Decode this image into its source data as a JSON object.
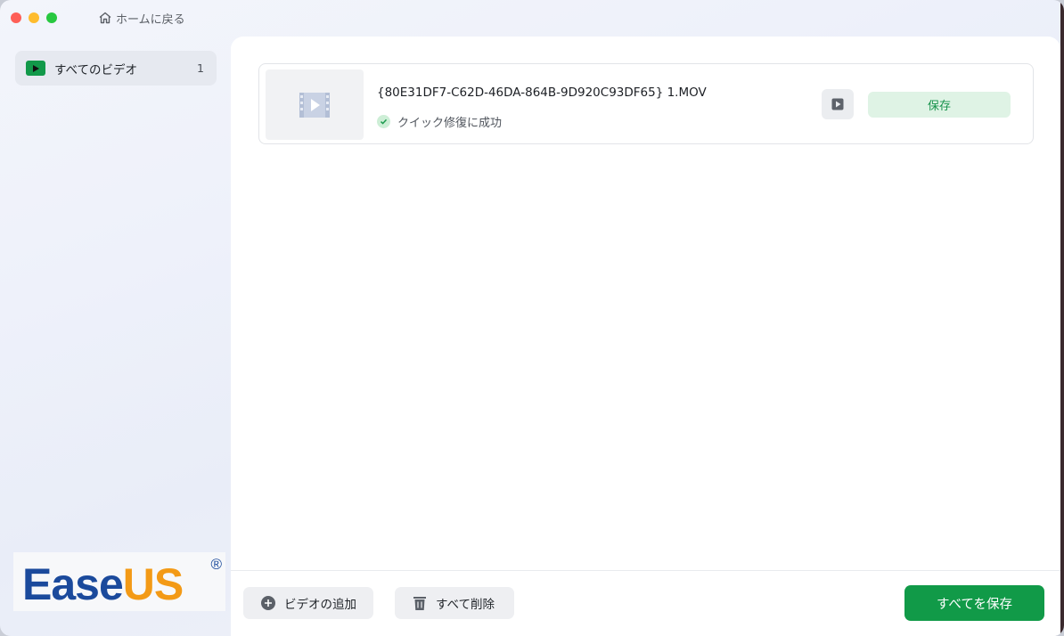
{
  "window": {
    "home_link": "ホームに戻る"
  },
  "sidebar": {
    "items": [
      {
        "label": "すべてのビデオ",
        "count": "1",
        "icon": "video-play-icon",
        "color": "#12994a"
      }
    ],
    "logo": {
      "part1": "Ease",
      "part2": "US",
      "mark": "®"
    }
  },
  "main": {
    "files": [
      {
        "name": "{80E31DF7-C62D-46DA-864B-9D920C93DF65} 1.MOV",
        "status": "クイック修復に成功",
        "save_label": "保存"
      }
    ]
  },
  "footer": {
    "add_video": "ビデオの追加",
    "delete_all": "すべて削除",
    "save_all": "すべてを保存"
  },
  "colors": {
    "accent": "#119a48",
    "accent_light": "#dff3e5"
  }
}
